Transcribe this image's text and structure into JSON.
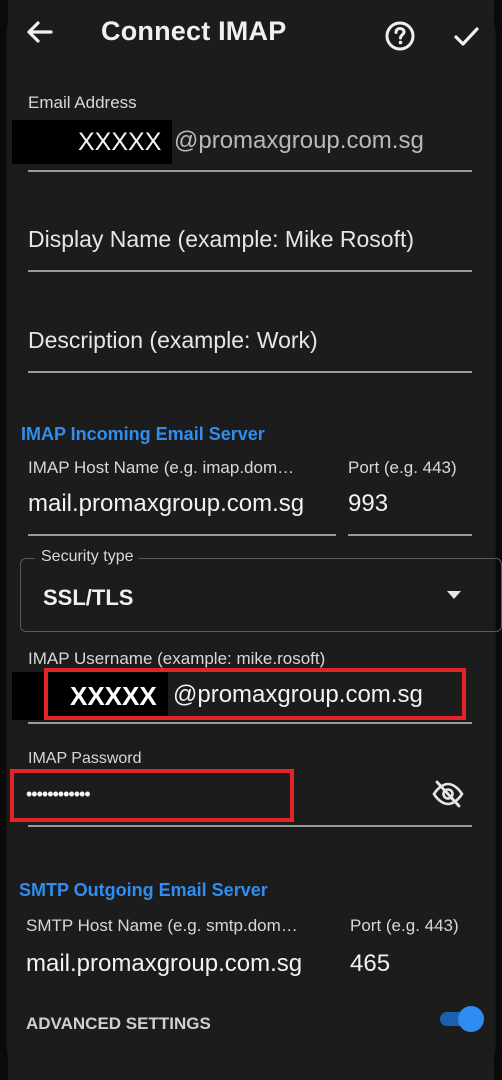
{
  "appbar": {
    "title": "Connect IMAP",
    "back_icon": "arrow-left-icon",
    "help_icon": "help-circle-icon",
    "done_icon": "check-icon"
  },
  "email": {
    "label": "Email Address",
    "masked_user": "XXXXX",
    "domain": "@promaxgroup.com.sg"
  },
  "display_name": {
    "placeholder": "Display Name (example: Mike Rosoft)"
  },
  "description": {
    "placeholder": "Description (example: Work)"
  },
  "imap": {
    "section_title": "IMAP Incoming Email Server",
    "host_label": "IMAP Host Name (e.g. imap.dom…",
    "host_value": "mail.promaxgroup.com.sg",
    "port_label": "Port (e.g. 443)",
    "port_value": "993",
    "security_label": "Security type",
    "security_value": "SSL/TLS",
    "username_label": "IMAP Username (example: mike.rosoft)",
    "username_masked": "XXXXX",
    "username_domain": "@promaxgroup.com.sg",
    "password_label": "IMAP Password",
    "password_value": "••••••••••••",
    "password_toggle_icon": "eye-off-icon"
  },
  "smtp": {
    "section_title": "SMTP Outgoing Email Server",
    "host_label": "SMTP Host Name (e.g. smtp.dom…",
    "host_value": "mail.promaxgroup.com.sg",
    "port_label": "Port (e.g. 443)",
    "port_value": "465"
  },
  "advanced": {
    "label": "ADVANCED SETTINGS",
    "enabled": true
  },
  "colors": {
    "accent": "#2f8ef0",
    "highlight_box": "#e0242a",
    "background": "#1c1c1d"
  }
}
